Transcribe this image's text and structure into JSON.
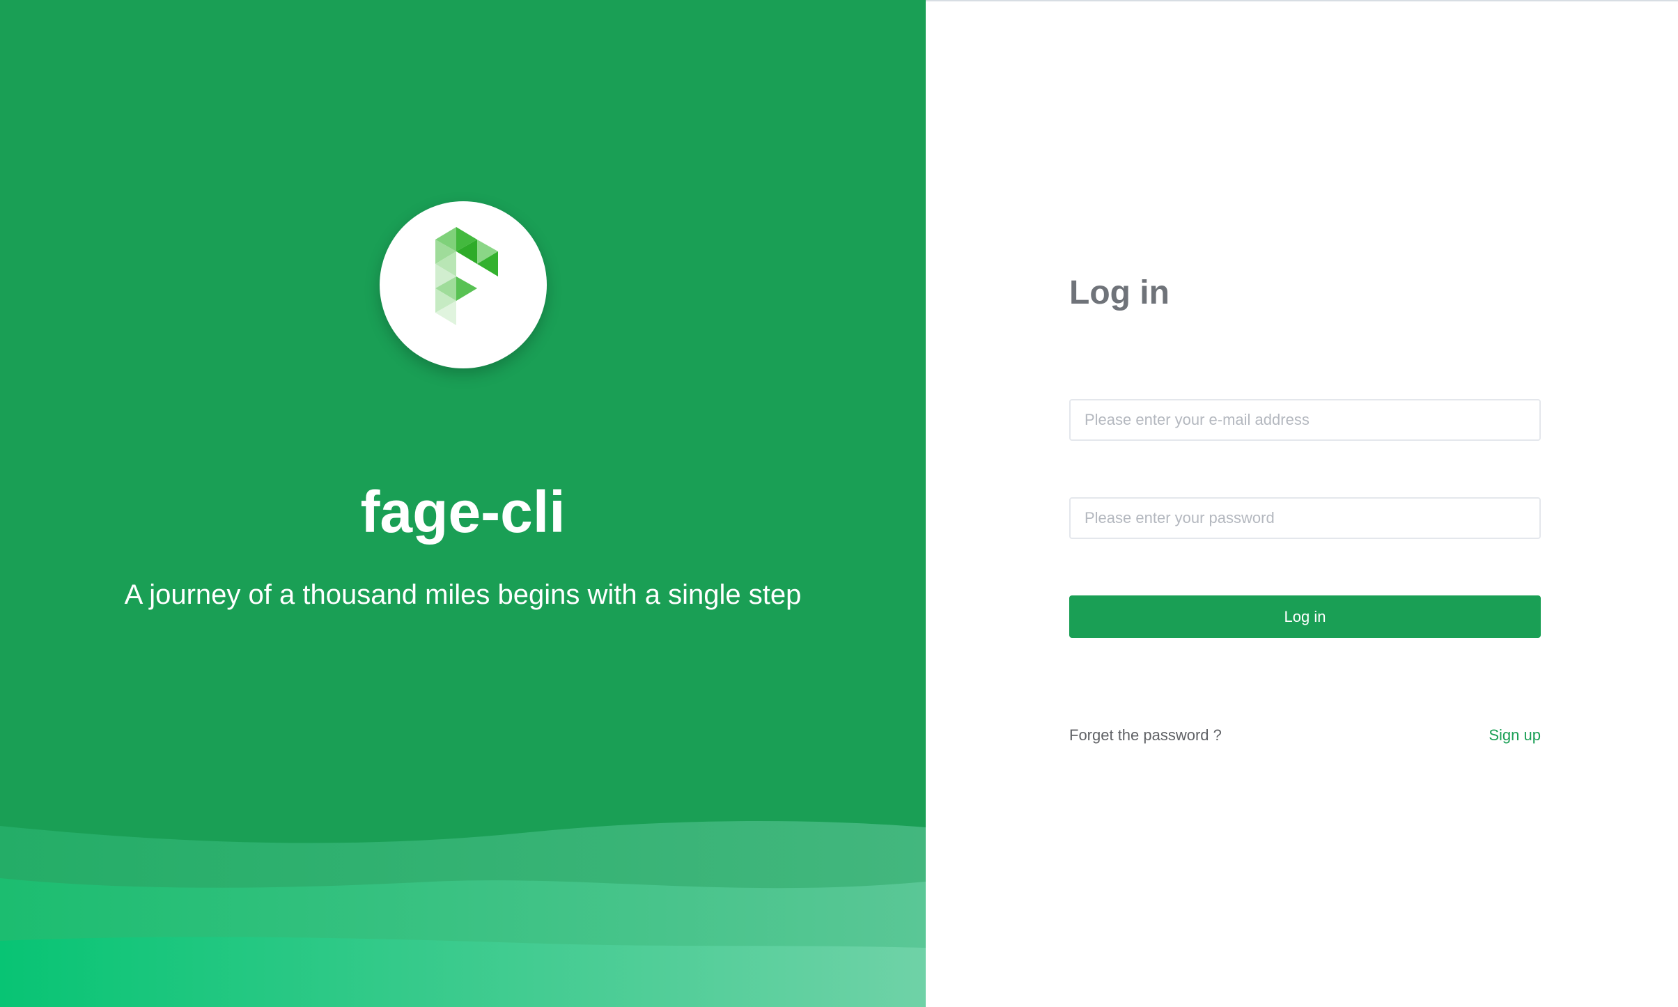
{
  "brand": {
    "name": "fage-cli",
    "slogan": "A journey of a thousand miles begins with a single step",
    "logo_icon": "fage-logo-icon"
  },
  "login": {
    "title": "Log in",
    "email_placeholder": "Please enter your e-mail address",
    "email_value": "",
    "password_placeholder": "Please enter your password",
    "password_value": "",
    "button_label": "Log in",
    "forget_label": "Forget the password ?",
    "signup_label": "Sign up"
  },
  "colors": {
    "primary": "#1a9f55",
    "wave_light": "#6dd3a4",
    "wave_mid": "#2ec07f",
    "title_gray": "#6f7379",
    "link_gray": "#606266"
  }
}
